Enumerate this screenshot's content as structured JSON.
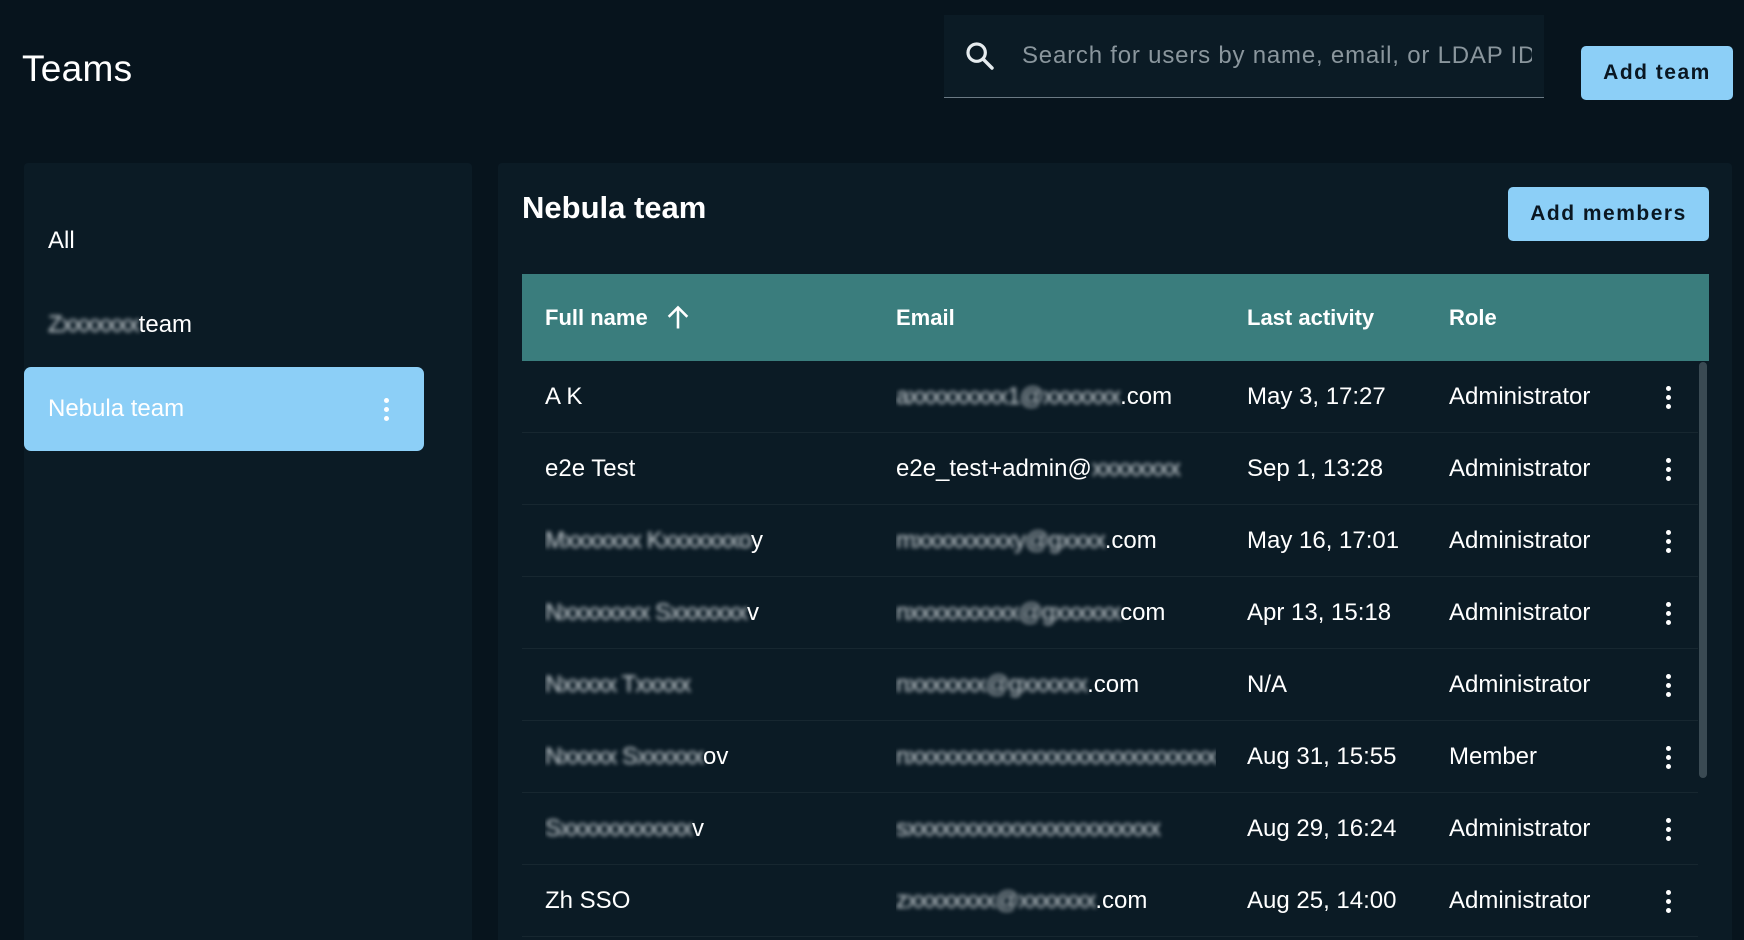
{
  "header": {
    "title": "Teams",
    "search_placeholder": "Search for users by name, email, or LDAP ID",
    "search_value": "",
    "add_team_label": "Add team"
  },
  "sidebar": {
    "items": [
      {
        "label": "All",
        "selected": false
      },
      {
        "label_redacted_part": "Zxxxxxxx",
        "label_suffix": "team",
        "selected": false
      },
      {
        "label": "Nebula team",
        "selected": true
      }
    ]
  },
  "main": {
    "title": "Nebula team",
    "add_members_label": "Add members",
    "columns": {
      "full_name": "Full name",
      "email": "Email",
      "last_activity": "Last activity",
      "role": "Role"
    },
    "sort": {
      "column": "Full name",
      "direction": "ascending"
    },
    "rows": [
      {
        "name": "A K",
        "name_redacted": false,
        "email_redacted": "axxxxxxxxx1@xxxxxxx",
        "email_visible": ".com",
        "last_activity": "May 3, 17:27",
        "role": "Administrator"
      },
      {
        "name": "e2e Test",
        "name_redacted": false,
        "email_redacted": "",
        "email_visible": "e2e_test+admin@",
        "email_tail_redacted": "xxxxxxxx",
        "last_activity": "Sep 1, 13:28",
        "role": "Administrator"
      },
      {
        "name": "Mxxxxxxx Kxxxxxxxo",
        "name_visible_suffix": "y",
        "name_redacted": true,
        "email_redacted": "mxxxxxxxxxy@gxxxx",
        "email_visible": ".com",
        "last_activity": "May 16, 17:01",
        "role": "Administrator"
      },
      {
        "name": "Nxxxxxxxx Sxxxxxxx",
        "name_visible_suffix": "v",
        "name_redacted": true,
        "email_redacted": "nxxxxxxxxxx@gxxxxxx",
        "email_visible": "com",
        "last_activity": "Apr 13, 15:18",
        "role": "Administrator"
      },
      {
        "name": "Nxxxxx Txxxxx",
        "name_visible_suffix": "",
        "name_redacted": true,
        "email_redacted": "nxxxxxxx@gxxxxxx",
        "email_visible": ".com",
        "last_activity": "N/A",
        "role": "Administrator"
      },
      {
        "name": "Nxxxxx Sxxxxxx",
        "name_visible_suffix": "ov",
        "name_redacted": true,
        "email_redacted": "nxxxxxxxxxxxxxxxxxxxxxxxxxxxx",
        "email_visible": "",
        "last_activity": "Aug 31, 15:55",
        "role": "Member"
      },
      {
        "name": "Sxxxxxxxxxxxx",
        "name_visible_suffix": "v",
        "name_redacted": true,
        "email_redacted": "sxxxxxxxxxxxxxxxxxxxxxxx",
        "email_visible": "",
        "last_activity": "Aug 29, 16:24",
        "role": "Administrator"
      },
      {
        "name": "Zh SSO",
        "name_redacted": false,
        "email_redacted": "zxxxxxxxx@xxxxxxx",
        "email_visible": ".com",
        "last_activity": "Aug 25, 14:00",
        "role": "Administrator"
      }
    ]
  },
  "colors": {
    "background": "#07141d",
    "panel": "#0b1b25",
    "accent": "#8ccff7",
    "table_header": "#3a7d7d"
  }
}
